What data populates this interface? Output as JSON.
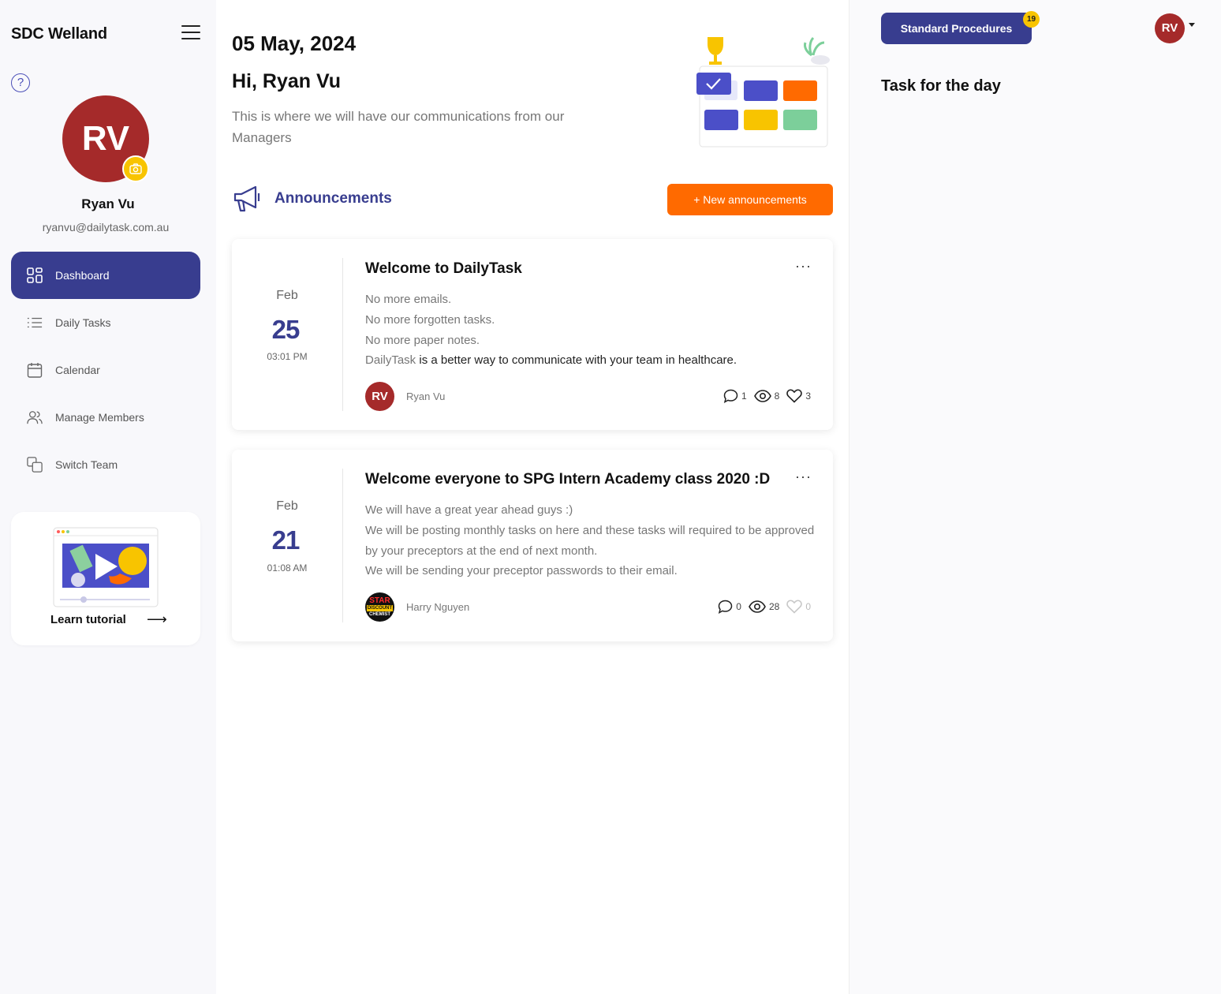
{
  "sidebar": {
    "brand": "SDC Welland",
    "profile": {
      "initials": "RV",
      "name": "Ryan Vu",
      "email": "ryanvu@dailytask.com.au"
    },
    "nav": [
      {
        "label": "Dashboard",
        "icon": "dashboard-grid-icon",
        "active": true
      },
      {
        "label": "Daily Tasks",
        "icon": "list-icon",
        "active": false
      },
      {
        "label": "Calendar",
        "icon": "calendar-icon",
        "active": false
      },
      {
        "label": "Manage Members",
        "icon": "users-icon",
        "active": false
      },
      {
        "label": "Switch Team",
        "icon": "switch-icon",
        "active": false
      }
    ],
    "tutorial": {
      "label": "Learn tutorial"
    }
  },
  "main": {
    "date": "05 May, 2024",
    "greeting": "Hi, Ryan Vu",
    "intro": "This is where we will have our communications from our Managers",
    "announcements_title": "Announcements",
    "new_button": "+ New announcements",
    "cards": [
      {
        "month": "Feb",
        "day": "25",
        "time": "03:01 PM",
        "title": "Welcome to DailyTask",
        "lines": [
          "No more emails.",
          "No more forgotten tasks.",
          "No more paper notes."
        ],
        "last_line_prefix": "DailyTask",
        "last_line_rest": " is a better way to communicate with your team in healthcare.",
        "author_initials": "RV",
        "author": "Ryan Vu",
        "comments": "1",
        "views": "8",
        "likes": "3"
      },
      {
        "month": "Feb",
        "day": "21",
        "time": "01:08 AM",
        "title": "Welcome everyone to SPG Intern Academy class 2020 :D",
        "lines": [
          "We will have a great year ahead guys :)",
          "We will be posting monthly tasks on here and these tasks will required to be approved by your preceptors at the end of next month.",
          "We will be sending your preceptor passwords to their email."
        ],
        "author_logo_text": [
          "STAR",
          "DISCOUNT",
          "CHEMIST"
        ],
        "author": "Harry Nguyen",
        "comments": "0",
        "views": "28",
        "likes": "0"
      }
    ]
  },
  "right": {
    "sp_button": "Standard Procedures",
    "sp_badge": "19",
    "user_initials": "RV",
    "task_title": "Task for the day"
  },
  "colors": {
    "primary": "#383d8f",
    "accent": "#ff6a00",
    "avatar": "#a52a2a",
    "badge": "#f8c400"
  }
}
